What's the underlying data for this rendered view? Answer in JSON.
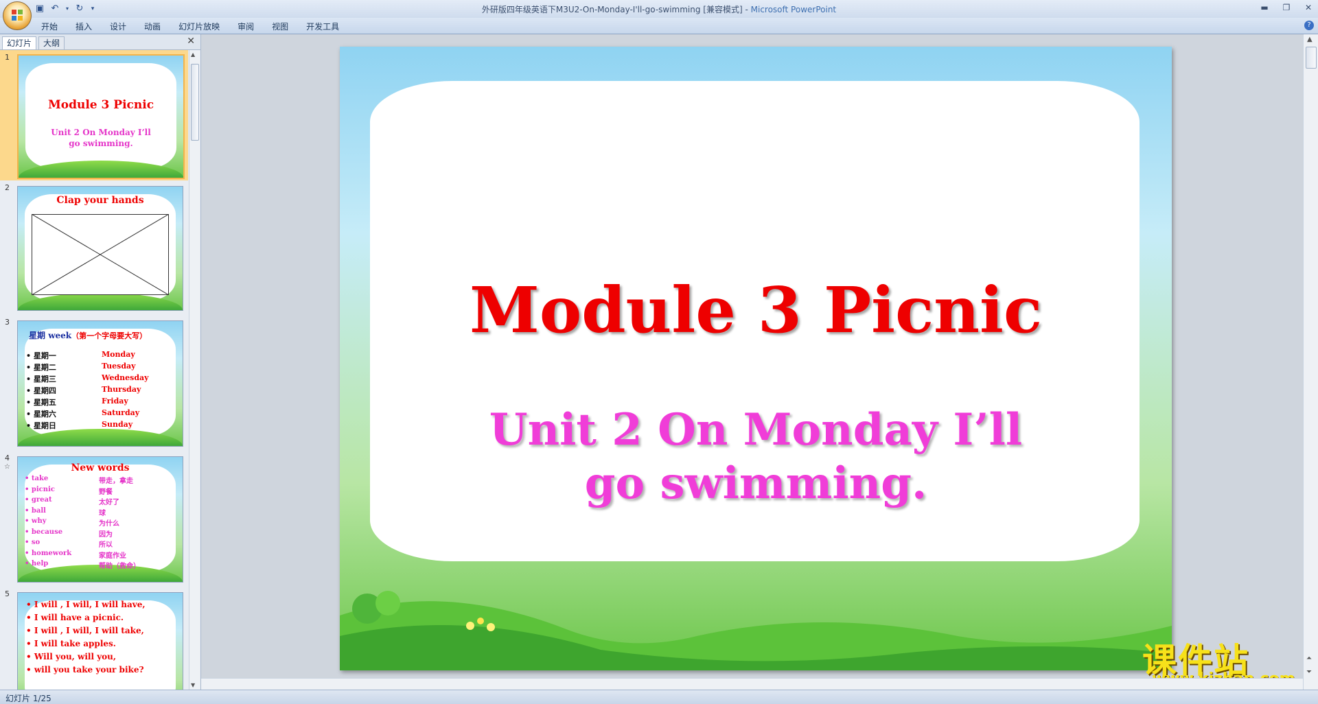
{
  "window": {
    "title": "外研版四年级英语下M3U2-On-Monday-I'll-go-swimming [兼容模式] - ",
    "app_name": "Microsoft PowerPoint"
  },
  "ribbon": {
    "tabs": [
      "开始",
      "插入",
      "设计",
      "动画",
      "幻灯片放映",
      "审阅",
      "视图",
      "开发工具"
    ]
  },
  "pane": {
    "tabs": [
      "幻灯片",
      "大纲"
    ]
  },
  "thumbnails": [
    {
      "num": "1",
      "title": "Module 3 Picnic",
      "subtitle": "Unit 2 On Monday I’ll go swimming."
    },
    {
      "num": "2",
      "title": "Clap your hands"
    },
    {
      "num": "3",
      "title_cn": "星期",
      "title_en": " week",
      "title_note": "（第一个字母要大写）",
      "rows": [
        [
          "星期一",
          "Monday"
        ],
        [
          "星期二",
          "Tuesday"
        ],
        [
          "星期三",
          "Wednesday"
        ],
        [
          "星期四",
          "Thursday"
        ],
        [
          "星期五",
          "Friday"
        ],
        [
          "星期六",
          "Saturday"
        ],
        [
          "星期日",
          "Sunday"
        ]
      ]
    },
    {
      "num": "4",
      "num_mark": "☆",
      "title": "New  words",
      "rows": [
        [
          "take",
          "带走，拿走"
        ],
        [
          "picnic",
          "野餐"
        ],
        [
          "great",
          "太好了"
        ],
        [
          "ball",
          "球"
        ],
        [
          "why",
          "为什么"
        ],
        [
          "because",
          "因为"
        ],
        [
          "so",
          "所以"
        ],
        [
          "homework",
          "家庭作业"
        ],
        [
          "help",
          "帮助（救命）"
        ]
      ]
    },
    {
      "num": "5",
      "lines": [
        "I will , I will, I will have,",
        "I will have a picnic.",
        "I will , I will, I will take,",
        "I will take apples.",
        "Will you, will you,",
        "will you take your bike?"
      ]
    }
  ],
  "slide": {
    "title": "Module 3 Picnic",
    "subtitle_line1": "Unit 2 On Monday I’ll",
    "subtitle_line2": "go swimming."
  },
  "watermark": {
    "chinese": "课件站",
    "url": "www.kjzhan.com"
  },
  "status": {
    "slide_counter": "幻灯片 1/25"
  },
  "colors": {
    "title_red": "#ee0000",
    "subtitle_pink": "#f03dd8",
    "selection": "#f3b34a",
    "watermark_yellow": "#f7e11a"
  }
}
